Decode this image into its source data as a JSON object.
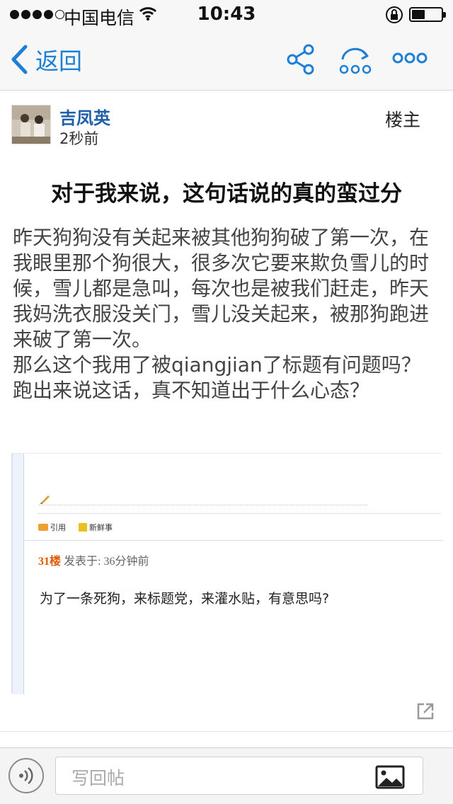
{
  "status_bar": {
    "carrier": "中国电信",
    "time": "10:43",
    "battery_level": 0.45
  },
  "nav": {
    "back_label": "返回",
    "icons": [
      "share-icon",
      "forward-icon",
      "more-icon"
    ]
  },
  "post": {
    "author": "吉凤英",
    "time": "2秒前",
    "role": "楼主",
    "title": "对于我来说，这句话说的真的蛮过分",
    "paragraphs": [
      "昨天狗狗没有关起来被其他狗狗破了第一次，在我眼里那个狗很大，很多次它要来欺负雪儿的时候，雪儿都是急叫，每次也是被我们赶走，昨天我妈洗衣服没关门，雪儿没关起来，被那狗跑进来破了第一次。",
      "那么这个我用了被qiangjian了标题有问题吗？",
      "跑出来说这话，真不知道出于什么心态？"
    ]
  },
  "embedded": {
    "quote_label": "引用",
    "news_label": "新鲜事",
    "floor_number": "31楼",
    "posted_label": "发表于: 36分钟前",
    "reply_text": "为了一条死狗，来标题党，来灌水贴，有意思吗?"
  },
  "bottom_bar": {
    "reply_placeholder": "写回帖"
  },
  "colors": {
    "accent": "#1e7fd6",
    "author": "#1d5fa8",
    "floor_number": "#e05a00"
  }
}
